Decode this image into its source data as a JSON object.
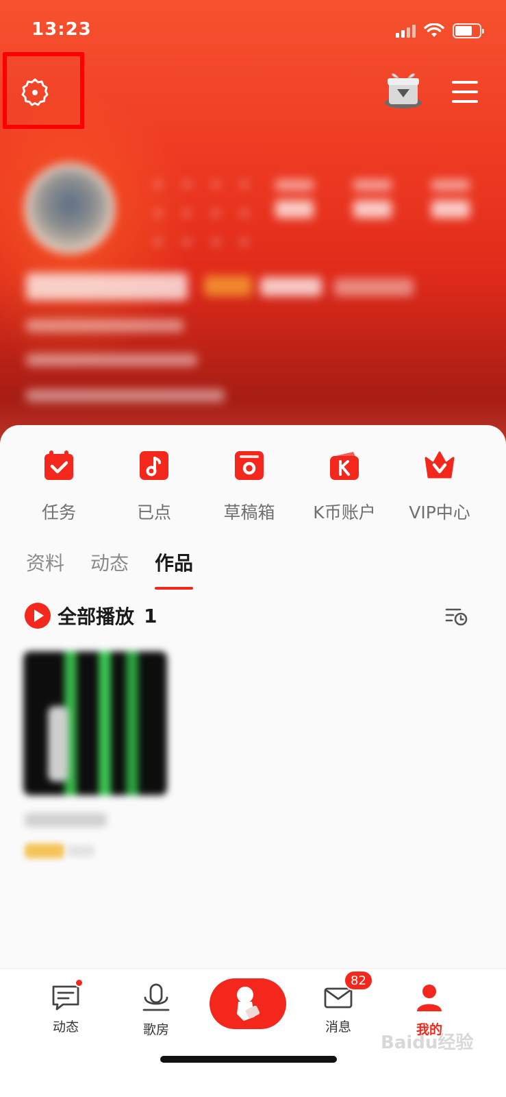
{
  "status_bar": {
    "time": "13:23"
  },
  "colors": {
    "accent": "#f3271c",
    "header_top": "#f6522f",
    "header_bottom": "#a71d14"
  },
  "shortcuts": [
    {
      "label": "任务",
      "icon": "calendar-check-icon"
    },
    {
      "label": "已点",
      "icon": "music-note-icon"
    },
    {
      "label": "草稿箱",
      "icon": "draft-box-icon"
    },
    {
      "label": "K币账户",
      "icon": "k-coin-wallet-icon"
    },
    {
      "label": "VIP中心",
      "icon": "vip-crown-icon"
    }
  ],
  "tabs": [
    {
      "label": "资料",
      "active": false
    },
    {
      "label": "动态",
      "active": false
    },
    {
      "label": "作品",
      "active": true
    }
  ],
  "play_all": {
    "label": "全部播放",
    "count": "1"
  },
  "bottom_nav": [
    {
      "label": "动态",
      "icon": "chat-feed-icon"
    },
    {
      "label": "歌房",
      "icon": "microphone-icon"
    },
    {
      "label": "",
      "icon": "sing-record-icon"
    },
    {
      "label": "消息",
      "icon": "mail-icon",
      "badge": "82"
    },
    {
      "label": "我的",
      "icon": "person-icon",
      "active": true
    }
  ],
  "watermark": "Baidu经验"
}
